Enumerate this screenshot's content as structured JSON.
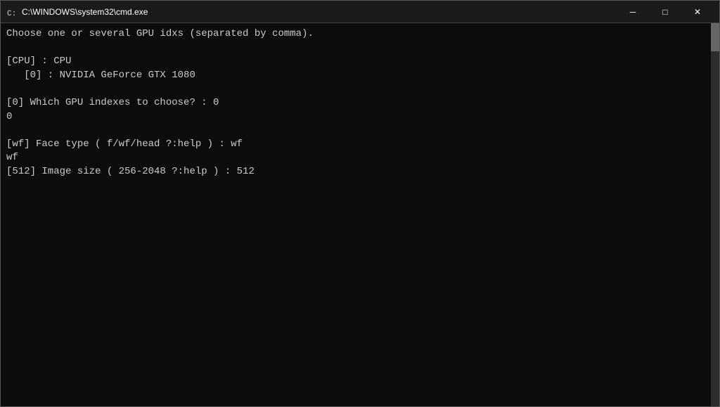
{
  "titleBar": {
    "icon": "cmd-icon",
    "title": "C:\\WINDOWS\\system32\\cmd.exe",
    "minimizeLabel": "─",
    "maximizeLabel": "□",
    "closeLabel": "✕"
  },
  "console": {
    "lines": [
      "Choose one or several GPU idxs (separated by comma).",
      "",
      "[CPU] : CPU",
      "   [0] : NVIDIA GeForce GTX 1080",
      "",
      "[0] Which GPU indexes to choose? : 0",
      "0",
      "",
      "[wf] Face type ( f/wf/head ?:help ) : wf",
      "wf",
      "[512] Image size ( 256-2048 ?:help ) : 512"
    ]
  }
}
